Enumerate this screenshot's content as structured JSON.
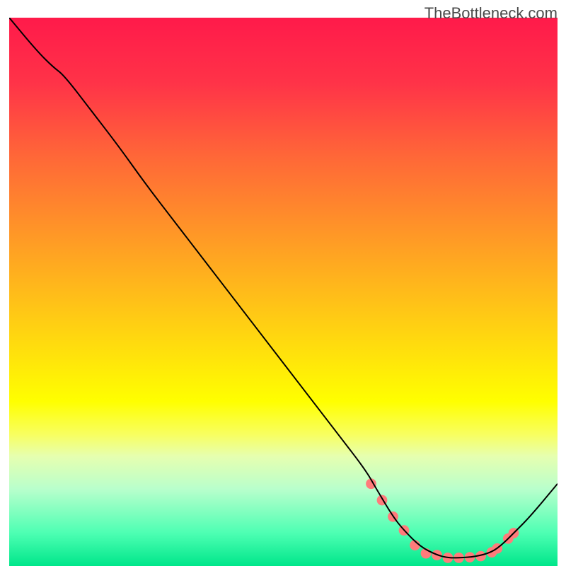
{
  "watermark": "TheBottleneck.com",
  "chart_data": {
    "type": "line",
    "title": "",
    "xlabel": "",
    "ylabel": "",
    "xlim": [
      0,
      100
    ],
    "ylim": [
      0,
      100
    ],
    "grid": false,
    "legend": false,
    "background_gradient": {
      "stops": [
        {
          "offset": 0.0,
          "color": "#ff1a4a"
        },
        {
          "offset": 0.12,
          "color": "#ff3348"
        },
        {
          "offset": 0.25,
          "color": "#ff6638"
        },
        {
          "offset": 0.4,
          "color": "#ff9926"
        },
        {
          "offset": 0.55,
          "color": "#ffcc14"
        },
        {
          "offset": 0.7,
          "color": "#ffff00"
        },
        {
          "offset": 0.76,
          "color": "#f8ff60"
        },
        {
          "offset": 0.8,
          "color": "#e6ffb0"
        },
        {
          "offset": 0.86,
          "color": "#b8ffcc"
        },
        {
          "offset": 0.94,
          "color": "#4dffb3"
        },
        {
          "offset": 1.0,
          "color": "#00e68a"
        }
      ]
    },
    "series": [
      {
        "name": "curve",
        "type": "line",
        "color": "#000000",
        "x": [
          0,
          5,
          8,
          10,
          15,
          20,
          25,
          30,
          35,
          40,
          45,
          50,
          55,
          60,
          65,
          67,
          70,
          72,
          75,
          78,
          80,
          82,
          85,
          88,
          90,
          92,
          95,
          100
        ],
        "y": [
          100,
          94,
          91,
          89.5,
          83,
          76.5,
          69.5,
          63,
          56.5,
          50,
          43.5,
          37,
          30.5,
          24,
          17.5,
          14,
          9,
          6.5,
          3.5,
          2,
          1.5,
          1.5,
          1.7,
          2.5,
          4,
          6,
          9,
          15
        ]
      },
      {
        "name": "markers",
        "type": "scatter",
        "color": "#ff7b7b",
        "radius": 7,
        "x": [
          66,
          68,
          70,
          72,
          74,
          76,
          78,
          80,
          82,
          84,
          86,
          88,
          89,
          91,
          92
        ],
        "y": [
          15,
          12,
          9,
          6.5,
          3.8,
          2.3,
          2.0,
          1.5,
          1.5,
          1.6,
          1.8,
          2.5,
          3.2,
          5.0,
          6.0
        ]
      }
    ]
  }
}
